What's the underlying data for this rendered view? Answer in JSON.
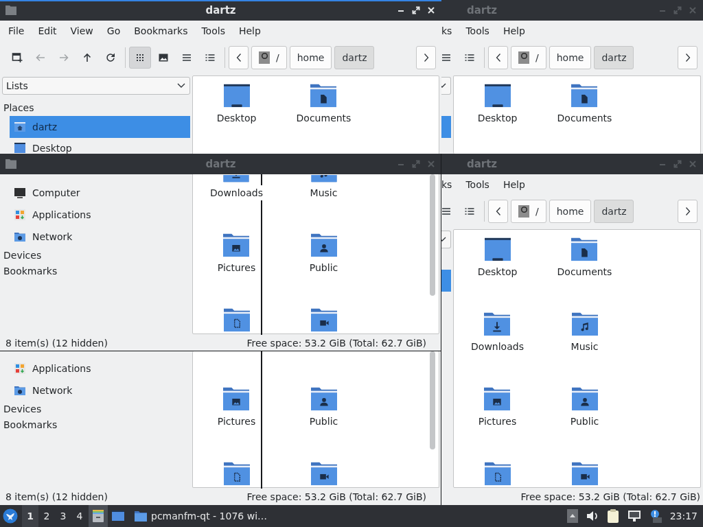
{
  "windows": [
    {
      "title": "dartz",
      "active": true,
      "menu": [
        "File",
        "Edit",
        "View",
        "Go",
        "Bookmarks",
        "Tools",
        "Help"
      ],
      "nav_tools": [
        {
          "kind": "new-tab",
          "disabled": false
        },
        {
          "kind": "back",
          "disabled": true
        },
        {
          "kind": "forward",
          "disabled": true
        },
        {
          "kind": "up",
          "disabled": false
        },
        {
          "kind": "reload",
          "disabled": false
        }
      ],
      "view_modes": [
        {
          "kind": "icons",
          "selected": true
        },
        {
          "kind": "thumbnails",
          "selected": false
        },
        {
          "kind": "compact",
          "selected": false
        },
        {
          "kind": "details",
          "selected": false
        }
      ],
      "path": [
        {
          "label": "/",
          "kind": "root",
          "selected": false
        },
        {
          "label": "home",
          "kind": "folder",
          "selected": false
        },
        {
          "label": "dartz",
          "kind": "folder",
          "selected": true
        }
      ],
      "sidebar": {
        "dropdown": "Lists",
        "header": "Places",
        "items": [
          {
            "label": "dartz",
            "kind": "home",
            "selected": true
          },
          {
            "label": "Desktop",
            "kind": "desktop",
            "selected": false
          },
          {
            "label": "Computer",
            "kind": "computer",
            "selected": false
          },
          {
            "label": "Applications",
            "kind": "applications",
            "selected": false
          },
          {
            "label": "Network",
            "kind": "network",
            "selected": false
          }
        ],
        "sections": [
          "Devices",
          "Bookmarks"
        ]
      },
      "files": [
        {
          "name": "Desktop",
          "kind": "desktop"
        },
        {
          "name": "Documents",
          "kind": "documents"
        },
        {
          "name": "Downloads",
          "kind": "downloads"
        },
        {
          "name": "Music",
          "kind": "music"
        },
        {
          "name": "Pictures",
          "kind": "pictures"
        },
        {
          "name": "Public",
          "kind": "public"
        },
        {
          "kind": "templates"
        },
        {
          "kind": "videos"
        }
      ],
      "status": {
        "left": "8 item(s) (12 hidden)",
        "right": "Free space: 53.2 GiB (Total: 62.7 GiB)"
      }
    },
    {
      "title": "dartz",
      "active": false,
      "menu": [
        "ks",
        "Tools",
        "Help"
      ],
      "view_modes": [
        {
          "kind": "compact",
          "selected": false
        },
        {
          "kind": "details",
          "selected": false
        }
      ],
      "path": [
        {
          "label": "/",
          "kind": "root",
          "selected": false
        },
        {
          "label": "home",
          "kind": "folder",
          "selected": false
        },
        {
          "label": "dartz",
          "kind": "folder",
          "selected": true
        }
      ],
      "sidebar_edge": {
        "item_selected": true
      },
      "files": [
        {
          "name": "Desktop",
          "kind": "desktop"
        },
        {
          "name": "Documents",
          "kind": "documents"
        }
      ]
    },
    {
      "title": "dartz",
      "active": false,
      "sidebar": {
        "items": [
          {
            "label": "Applications",
            "kind": "applications",
            "selected": false
          },
          {
            "label": "Network",
            "kind": "network",
            "selected": false
          }
        ],
        "sections": [
          "Devices",
          "Bookmarks"
        ]
      },
      "files": [
        {
          "name": "Pictures",
          "kind": "pictures"
        },
        {
          "name": "Public",
          "kind": "public"
        },
        {
          "kind": "templates"
        },
        {
          "kind": "videos"
        }
      ],
      "status": {
        "left": "8 item(s) (12 hidden)",
        "right": "Free space: 53.2 GiB (Total: 62.7 GiB)"
      }
    },
    {
      "title": "dartz",
      "active": false,
      "menu": [
        "ks",
        "Tools",
        "Help"
      ],
      "view_modes": [
        {
          "kind": "compact",
          "selected": false
        },
        {
          "kind": "details",
          "selected": false
        }
      ],
      "path": [
        {
          "label": "/",
          "kind": "root",
          "selected": false
        },
        {
          "label": "home",
          "kind": "folder",
          "selected": false
        },
        {
          "label": "dartz",
          "kind": "folder",
          "selected": true
        }
      ],
      "sidebar_edge": {
        "item_selected": true
      },
      "files": [
        {
          "name": "Desktop",
          "kind": "desktop"
        },
        {
          "name": "Documents",
          "kind": "documents"
        },
        {
          "name": "Downloads",
          "kind": "downloads"
        },
        {
          "name": "Music",
          "kind": "music"
        },
        {
          "name": "Pictures",
          "kind": "pictures"
        },
        {
          "name": "Public",
          "kind": "public"
        },
        {
          "kind": "templates"
        },
        {
          "kind": "videos"
        }
      ],
      "status": {
        "right": "Free space: 53.2 GiB (Total: 62.7 GiB)"
      }
    }
  ],
  "taskbar": {
    "workspaces": [
      {
        "label": "1",
        "selected": true
      },
      {
        "label": "2",
        "selected": false
      },
      {
        "label": "3",
        "selected": false
      },
      {
        "label": "4",
        "selected": false
      }
    ],
    "launchers": [
      {
        "kind": "file-manager",
        "selected": true
      },
      {
        "kind": "show-desktop",
        "selected": false
      }
    ],
    "tasks": [
      {
        "label": "pcmanfm-qt - 1076 wi…"
      }
    ],
    "clock": "23:17"
  }
}
